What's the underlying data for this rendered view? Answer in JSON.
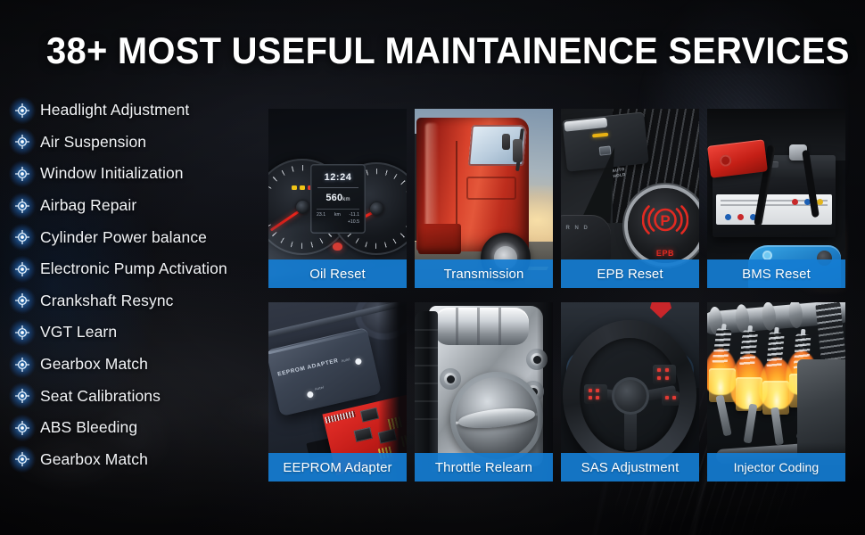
{
  "headline": "38+ MOST USEFUL MAINTAINENCE SERVICES",
  "colors": {
    "accent_blue": "#157dd3",
    "label_bar": "#1a7fd4",
    "background": "#0a0a0c",
    "text_primary": "#ffffff",
    "bullet_glow": "#3896f0",
    "epb_red": "#e22a22"
  },
  "services": {
    "icon": "crosshair-target-icon",
    "items": [
      {
        "label": "Headlight Adjustment"
      },
      {
        "label": "Air Suspension"
      },
      {
        "label": "Window Initialization"
      },
      {
        "label": "Airbag Repair"
      },
      {
        "label": "Cylinder Power balance"
      },
      {
        "label": "Electronic Pump Activation"
      },
      {
        "label": "Crankshaft Resync"
      },
      {
        "label": "VGT Learn"
      },
      {
        "label": "Gearbox Match"
      },
      {
        "label": "Seat Calibrations"
      },
      {
        "label": " ABS Bleeding"
      },
      {
        "label": "Gearbox Match"
      }
    ]
  },
  "cards": [
    {
      "label": "Oil Reset",
      "art": "instrument-cluster"
    },
    {
      "label": "Transmission",
      "art": "red-semi-truck"
    },
    {
      "label": "EPB Reset",
      "art": "center-console-epb-switch"
    },
    {
      "label": "BMS Reset",
      "art": "car-battery"
    },
    {
      "label": "EEPROM Adapter",
      "art": "eeprom-adapter-device"
    },
    {
      "label": "Throttle Relearn",
      "art": "throttle-body"
    },
    {
      "label": "SAS Adjustment",
      "art": "steering-wheel"
    },
    {
      "label": "Injector Coding",
      "art": "engine-pistons-flames"
    }
  ],
  "card_art_text": {
    "cluster_time": "12:24",
    "cluster_distance": "560",
    "cluster_distance_unit": "km",
    "cluster_row_left": "23.1",
    "cluster_row_mid": "km",
    "cluster_row_right": "-11.1",
    "cluster_row_bottom": "+10.5",
    "epb_autohold": "AUTO\nHOLD",
    "epb_symbol_letter": "P",
    "epb_symbol_text": "EPB",
    "eeprom_device_text": "EEPROM ADAPTER",
    "eeprom_device_tag": "Autel"
  }
}
